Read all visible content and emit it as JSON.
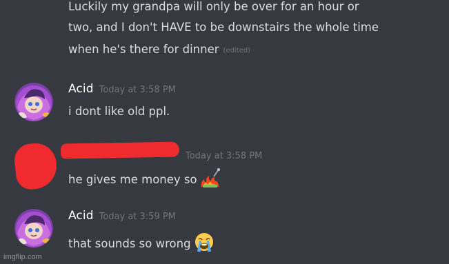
{
  "previous_message": {
    "lines": [
      "Luckily my grandpa will only be over for an hour or",
      "two, and I don't HAVE to be downstairs the whole time",
      "when he's there for dinner"
    ],
    "edited_label": "(edited)"
  },
  "messages": [
    {
      "username": "Acid",
      "timestamp": "Today at 3:58 PM",
      "content": "i dont like old ppl.",
      "avatar": "anime-character-avatar"
    },
    {
      "username": "",
      "timestamp": "Today at 3:58 PM",
      "content": "he gives me money so",
      "emoji": "money-with-fire-emoji",
      "avatar": "redacted-avatar"
    },
    {
      "username": "Acid",
      "timestamp": "Today at 3:59 PM",
      "content": "that sounds so wrong",
      "emoji": "loudly-crying-face-emoji",
      "avatar": "anime-character-avatar"
    }
  ],
  "watermark": "imgflip.com",
  "colors": {
    "background": "#36393f",
    "text": "#dcddde",
    "username": "#ffffff",
    "timestamp": "#72767d",
    "redaction": "#ef2b30"
  }
}
